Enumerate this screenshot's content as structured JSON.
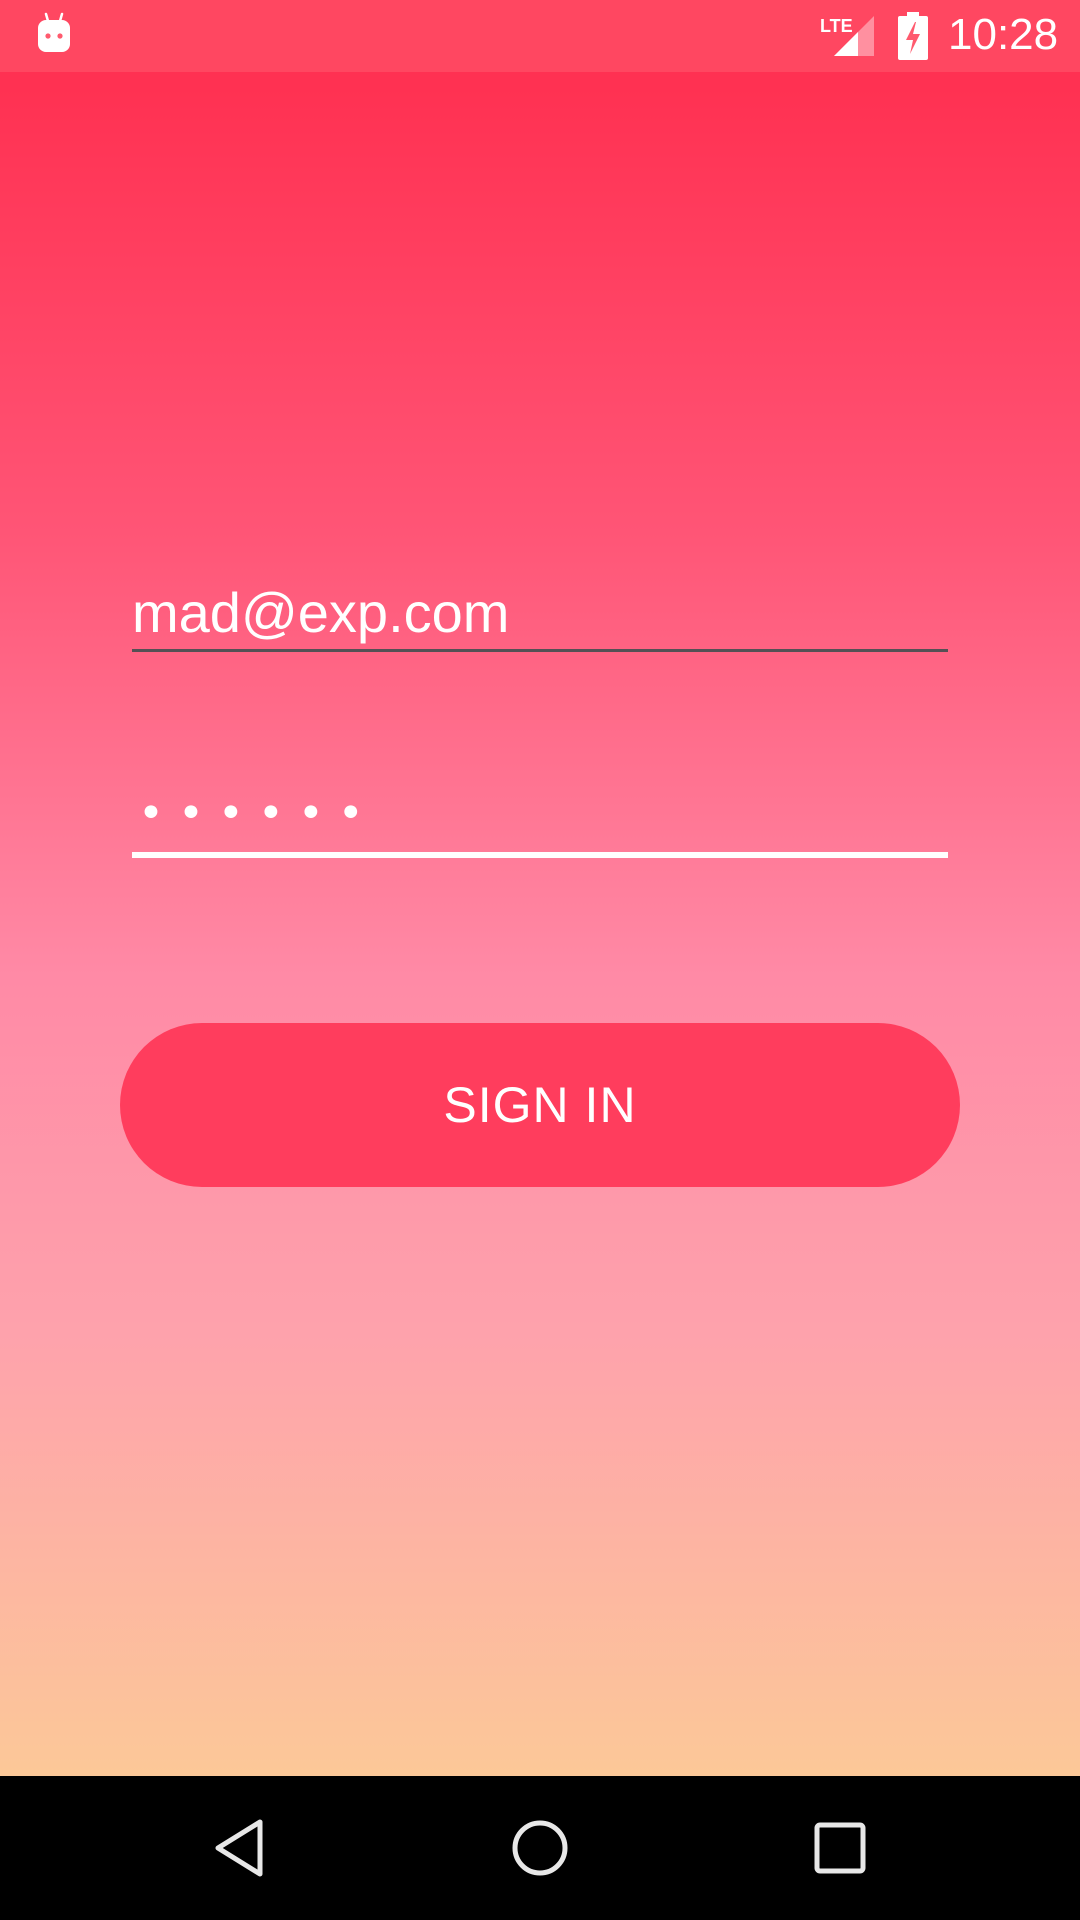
{
  "status_bar": {
    "time": "10:28",
    "network": "LTE",
    "notification_icon": "android-icon",
    "battery_icon": "battery-charging-icon",
    "signal_icon": "signal-icon"
  },
  "login_form": {
    "email_value": "mad@exp.com",
    "password_masked": "••••••",
    "sign_in_label": "SIGN IN"
  },
  "navigation_bar": {
    "back_icon": "back-icon",
    "home_icon": "home-icon",
    "recents_icon": "recents-icon"
  },
  "colors": {
    "gradient_top": "#ff3152",
    "gradient_mid": "#ff8aa6",
    "gradient_bottom": "#fcc898",
    "button": "#ff3d5d",
    "text": "#ffffff"
  }
}
